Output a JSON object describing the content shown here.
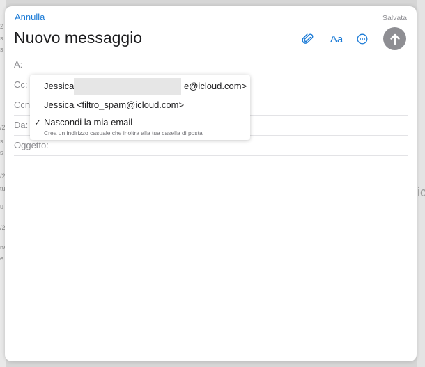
{
  "compose": {
    "cancel_label": "Annulla",
    "saved_label": "Salvata",
    "title": "Nuovo messaggio",
    "format_label": "Aa",
    "fields": {
      "to_label": "A:",
      "cc_label": "Cc:",
      "bcc_label": "Ccn:",
      "from_label": "Da:",
      "subject_label": "Oggetto:"
    }
  },
  "from_menu": {
    "options": [
      {
        "name_label": "Jessica",
        "address_suffix": "e@icloud.com>",
        "redacted": true
      },
      {
        "label": "Jessica <filtro_spam@icloud.com>"
      },
      {
        "label": "Nascondi la mia email",
        "description": "Crea un indirizzo casuale che inoltra alla tua casella di posta",
        "checked": true
      }
    ],
    "check_glyph": "✓"
  },
  "colors": {
    "accent": "#1a7ad6",
    "send_button": "#8e8e93"
  },
  "icons": [
    "paperclip-icon",
    "more-icon",
    "arrow-up-icon",
    "checkmark-icon"
  ]
}
